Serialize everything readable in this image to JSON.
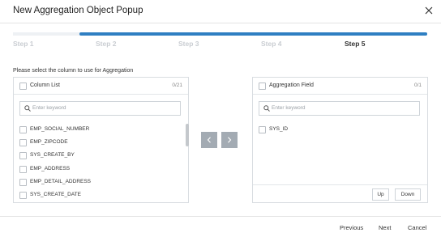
{
  "dialog": {
    "title": "New Aggregation Object Popup"
  },
  "steps": {
    "progress_fraction": 0.84,
    "items": [
      {
        "label": "Step 1",
        "active": false
      },
      {
        "label": "Step 2",
        "active": false
      },
      {
        "label": "Step 3",
        "active": false
      },
      {
        "label": "Step 4",
        "active": false
      },
      {
        "label": "Step 5",
        "active": true
      }
    ]
  },
  "instruction": "Please select the column to use for Aggregation",
  "column_list": {
    "header": "Column List",
    "count": "0/21",
    "search_placeholder": "Enter keyword",
    "items": [
      "EMP_SOCIAL_NUMBER",
      "EMP_ZIPCODE",
      "SYS_CREATE_BY",
      "EMP_ADDRESS",
      "EMP_DETAIL_ADDRESS",
      "SYS_CREATE_DATE"
    ]
  },
  "aggregation_field": {
    "header": "Aggregation Field",
    "count": "0/1",
    "search_placeholder": "Enter keyword",
    "items": [
      "SYS_ID"
    ],
    "up_label": "Up",
    "down_label": "Down"
  },
  "footer": {
    "previous": "Previous",
    "next": "Next",
    "cancel": "Cancel"
  },
  "colors": {
    "accent": "#2f7fc2",
    "arrow_button": "#a3abb3",
    "inactive_step": "#c9cdd2"
  },
  "icons": {
    "close": "close-icon",
    "search": "search-icon",
    "move_left": "chevron-left-icon",
    "move_right": "chevron-right-icon"
  }
}
